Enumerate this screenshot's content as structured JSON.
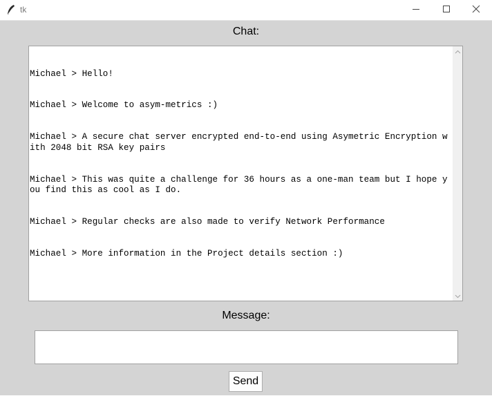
{
  "window": {
    "title": "tk"
  },
  "chat": {
    "label": "Chat:",
    "messages": [
      "Michael > Hello!",
      "Michael > Welcome to asym-metrics :)",
      "Michael > A secure chat server encrypted end-to-end using Asymetric Encryption with 2048 bit RSA key pairs",
      "Michael > This was quite a challenge for 36 hours as a one-man team but I hope you find this as cool as I do.",
      "Michael > Regular checks are also made to verify Network Performance",
      "Michael > More information in the Project details section :)"
    ]
  },
  "message": {
    "label": "Message:",
    "value": ""
  },
  "send": {
    "label": "Send"
  },
  "icons": {
    "app": "feather-icon",
    "minimize": "minimize-icon",
    "maximize": "maximize-icon",
    "close": "close-icon",
    "scroll_up": "chevron-up-icon",
    "scroll_down": "chevron-down-icon"
  },
  "colors": {
    "window_bg": "#d4d4d4",
    "field_bg": "#ffffff",
    "titlebar_bg": "#ffffff"
  }
}
